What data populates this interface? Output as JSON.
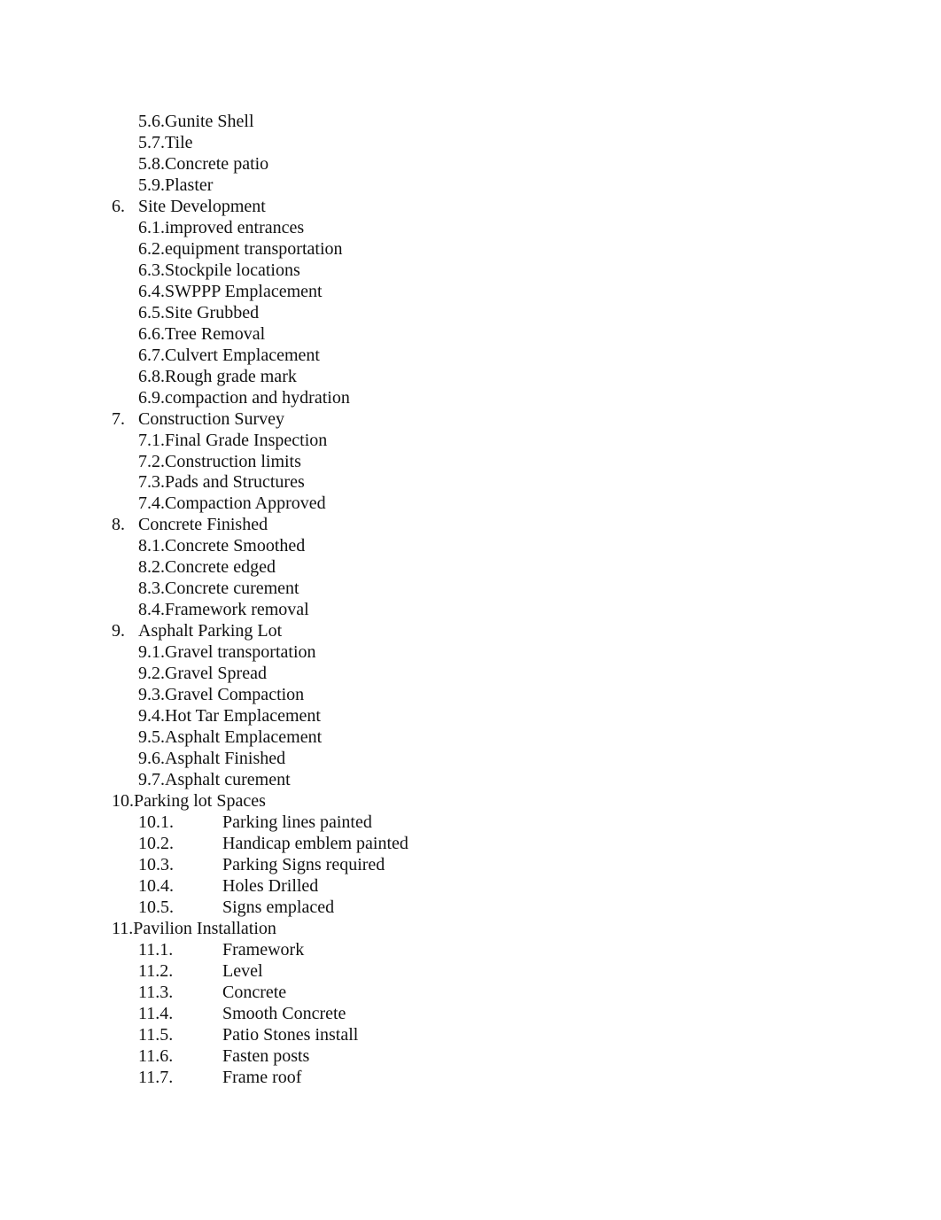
{
  "document": {
    "outline": [
      {
        "level": 2,
        "num": "5.6.",
        "text": "Gunite Shell",
        "style": "inline"
      },
      {
        "level": 2,
        "num": "5.7.",
        "text": "Tile",
        "style": "inline"
      },
      {
        "level": 2,
        "num": "5.8.",
        "text": "Concrete patio",
        "style": "inline"
      },
      {
        "level": 2,
        "num": "5.9.",
        "text": "Plaster",
        "style": "inline"
      },
      {
        "level": 1,
        "num": "6.",
        "text": "Site Development",
        "style": "tab"
      },
      {
        "level": 2,
        "num": "6.1.",
        "text": "improved entrances",
        "style": "inline"
      },
      {
        "level": 2,
        "num": "6.2.",
        "text": "equipment transportation",
        "style": "inline"
      },
      {
        "level": 2,
        "num": "6.3.",
        "text": "Stockpile locations",
        "style": "inline"
      },
      {
        "level": 2,
        "num": "6.4.",
        "text": "SWPPP Emplacement",
        "style": "inline"
      },
      {
        "level": 2,
        "num": "6.5.",
        "text": "Site Grubbed",
        "style": "inline"
      },
      {
        "level": 2,
        "num": "6.6.",
        "text": "Tree Removal",
        "style": "inline"
      },
      {
        "level": 2,
        "num": "6.7.",
        "text": "Culvert Emplacement",
        "style": "inline"
      },
      {
        "level": 2,
        "num": "6.8.",
        "text": "Rough grade mark",
        "style": "inline"
      },
      {
        "level": 2,
        "num": "6.9.",
        "text": "compaction and hydration",
        "style": "inline"
      },
      {
        "level": 1,
        "num": "7.",
        "text": "Construction Survey",
        "style": "tab"
      },
      {
        "level": 2,
        "num": "7.1.",
        "text": "Final Grade Inspection",
        "style": "inline"
      },
      {
        "level": 2,
        "num": "7.2.",
        "text": "Construction limits",
        "style": "inline"
      },
      {
        "level": 2,
        "num": "7.3.",
        "text": "Pads and Structures",
        "style": "inline"
      },
      {
        "level": 2,
        "num": "7.4.",
        "text": "Compaction Approved",
        "style": "inline"
      },
      {
        "level": 1,
        "num": "8.",
        "text": "Concrete Finished",
        "style": "tab"
      },
      {
        "level": 2,
        "num": "8.1.",
        "text": "Concrete Smoothed",
        "style": "inline"
      },
      {
        "level": 2,
        "num": "8.2.",
        "text": "Concrete edged",
        "style": "inline"
      },
      {
        "level": 2,
        "num": "8.3.",
        "text": "Concrete curement",
        "style": "inline"
      },
      {
        "level": 2,
        "num": "8.4.",
        "text": "Framework removal",
        "style": "inline"
      },
      {
        "level": 1,
        "num": "9.",
        "text": "Asphalt Parking Lot",
        "style": "tab"
      },
      {
        "level": 2,
        "num": "9.1.",
        "text": "Gravel transportation",
        "style": "inline"
      },
      {
        "level": 2,
        "num": "9.2.",
        "text": "Gravel Spread",
        "style": "inline"
      },
      {
        "level": 2,
        "num": "9.3.",
        "text": "Gravel Compaction",
        "style": "inline"
      },
      {
        "level": 2,
        "num": "9.4.",
        "text": "Hot Tar Emplacement",
        "style": "inline"
      },
      {
        "level": 2,
        "num": "9.5.",
        "text": "Asphalt Emplacement",
        "style": "inline"
      },
      {
        "level": 2,
        "num": "9.6.",
        "text": "Asphalt Finished",
        "style": "inline"
      },
      {
        "level": 2,
        "num": "9.7.",
        "text": "Asphalt curement",
        "style": "inline"
      },
      {
        "level": 1,
        "num": "10.",
        "text": "Parking lot Spaces",
        "style": "inline"
      },
      {
        "level": 2,
        "num": "10.1.",
        "text": "Parking lines painted",
        "style": "tab"
      },
      {
        "level": 2,
        "num": "10.2.",
        "text": "Handicap emblem painted",
        "style": "tab"
      },
      {
        "level": 2,
        "num": "10.3.",
        "text": "Parking Signs required",
        "style": "tab"
      },
      {
        "level": 2,
        "num": "10.4.",
        "text": "Holes Drilled",
        "style": "tab"
      },
      {
        "level": 2,
        "num": "10.5.",
        "text": "Signs emplaced",
        "style": "tab"
      },
      {
        "level": 1,
        "num": "11.",
        "text": "Pavilion Installation",
        "style": "inline"
      },
      {
        "level": 2,
        "num": "11.1.",
        "text": "Framework",
        "style": "tab"
      },
      {
        "level": 2,
        "num": "11.2.",
        "text": "Level",
        "style": "tab"
      },
      {
        "level": 2,
        "num": "11.3.",
        "text": "Concrete",
        "style": "tab"
      },
      {
        "level": 2,
        "num": "11.4.",
        "text": "Smooth Concrete",
        "style": "tab"
      },
      {
        "level": 2,
        "num": "11.5.",
        "text": "Patio Stones install",
        "style": "tab"
      },
      {
        "level": 2,
        "num": "11.6.",
        "text": "Fasten posts",
        "style": "tab"
      },
      {
        "level": 2,
        "num": "11.7.",
        "text": "Frame roof",
        "style": "tab"
      }
    ]
  }
}
